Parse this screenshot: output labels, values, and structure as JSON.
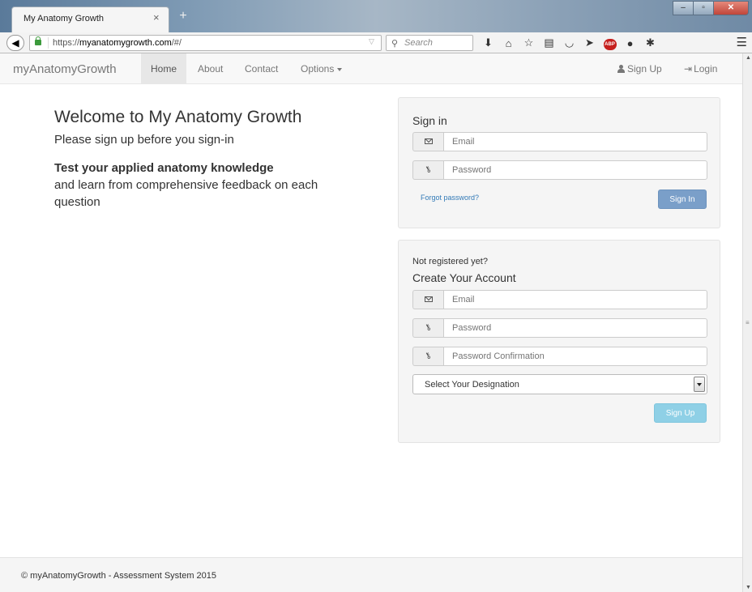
{
  "browser": {
    "tab_title": "My Anatomy Growth",
    "tab_close": "×",
    "new_tab": "+",
    "url_prefix": "https://",
    "url_host": "myanatomygrowth.com",
    "url_path": "/#/",
    "search_placeholder": "Search"
  },
  "nav": {
    "brand": "myAnatomyGrowth",
    "items": [
      {
        "label": "Home"
      },
      {
        "label": "About"
      },
      {
        "label": "Contact"
      },
      {
        "label": "Options"
      }
    ],
    "signup_label": "Sign Up",
    "login_label": "Login"
  },
  "hero": {
    "title": "Welcome to My Anatomy Growth",
    "subtitle": "Please sign up before you sign-in",
    "bold_line": "Test your applied anatomy knowledge",
    "text_line": "and learn from comprehensive feedback on each question"
  },
  "signin": {
    "heading": "Sign in",
    "email_placeholder": "Email",
    "password_placeholder": "Password",
    "forgot": "Forgot password?",
    "button": "Sign In"
  },
  "signup": {
    "note": "Not registered yet?",
    "heading": "Create Your Account",
    "email_placeholder": "Email",
    "password_placeholder": "Password",
    "confirm_placeholder": "Password Confirmation",
    "designation_selected": "Select Your Designation",
    "button": "Sign Up"
  },
  "footer": {
    "text": "© myAnatomyGrowth - Assessment System 2015"
  },
  "colors": {
    "signin_button": "#7a9fc9",
    "signup_button": "#8fd0e6",
    "link": "#337ab7"
  }
}
